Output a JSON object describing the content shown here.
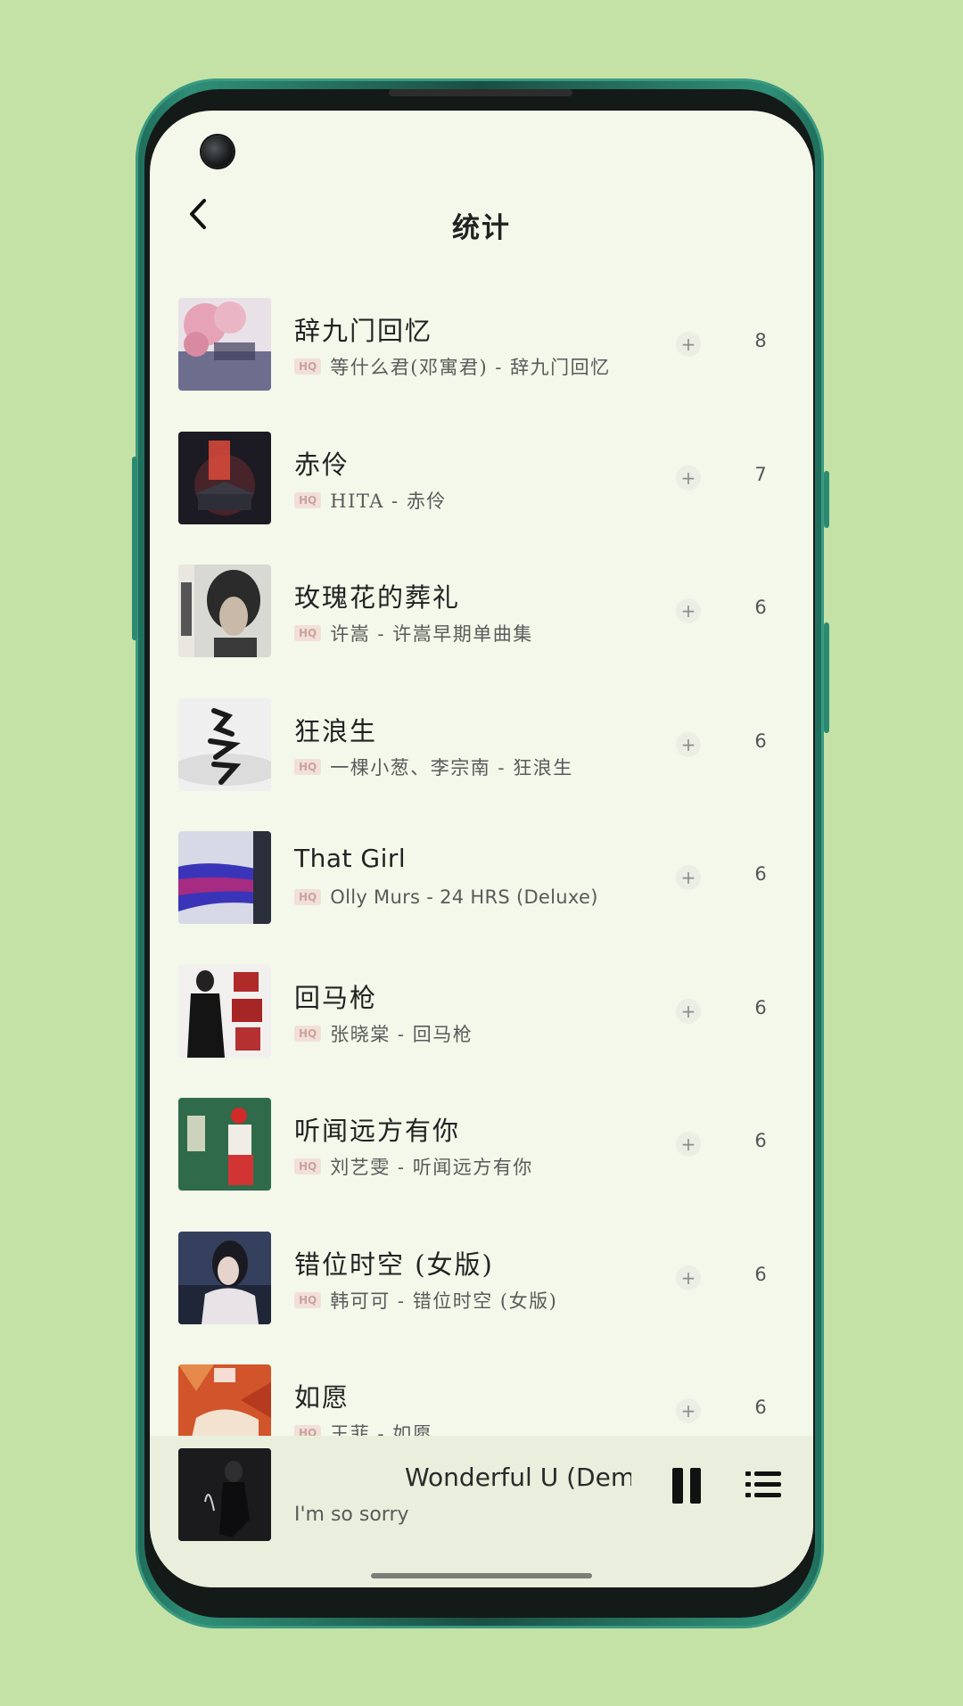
{
  "header": {
    "title": "统计",
    "back_icon": "chevron-left-icon"
  },
  "songs": [
    {
      "title": "辞九门回忆",
      "quality": "HQ",
      "subtitle": "等什么君(邓寓君) - 辞九门回忆",
      "count": "8"
    },
    {
      "title": "赤伶",
      "quality": "HQ",
      "subtitle": "HITA - 赤伶",
      "count": "7"
    },
    {
      "title": "玫瑰花的葬礼",
      "quality": "HQ",
      "subtitle": "许嵩 - 许嵩早期单曲集",
      "count": "6"
    },
    {
      "title": "狂浪生",
      "quality": "HQ",
      "subtitle": "一棵小葱、李宗南 - 狂浪生",
      "count": "6"
    },
    {
      "title": "That Girl",
      "quality": "HQ",
      "subtitle": "Olly Murs - 24 HRS (Deluxe)",
      "count": "6"
    },
    {
      "title": "回马枪",
      "quality": "HQ",
      "subtitle": "张晓棠 - 回马枪",
      "count": "6"
    },
    {
      "title": "听闻远方有你",
      "quality": "HQ",
      "subtitle": "刘艺雯 - 听闻远方有你",
      "count": "6"
    },
    {
      "title": "错位时空 (女版)",
      "quality": "HQ",
      "subtitle": "韩可可 - 错位时空 (女版)",
      "count": "6"
    },
    {
      "title": "如愿",
      "quality": "HQ",
      "subtitle": "王菲 - 如愿",
      "count": "6"
    }
  ],
  "player": {
    "title": "Wonderful U (Dem",
    "subtitle": "I'm so sorry",
    "pause_icon": "pause-icon",
    "playlist_icon": "playlist-icon"
  },
  "colors": {
    "background": "#c5e2a6",
    "screen": "#f3f8ea",
    "player_bar": "#e9efdc",
    "hq_badge": "#f2dfd8"
  }
}
